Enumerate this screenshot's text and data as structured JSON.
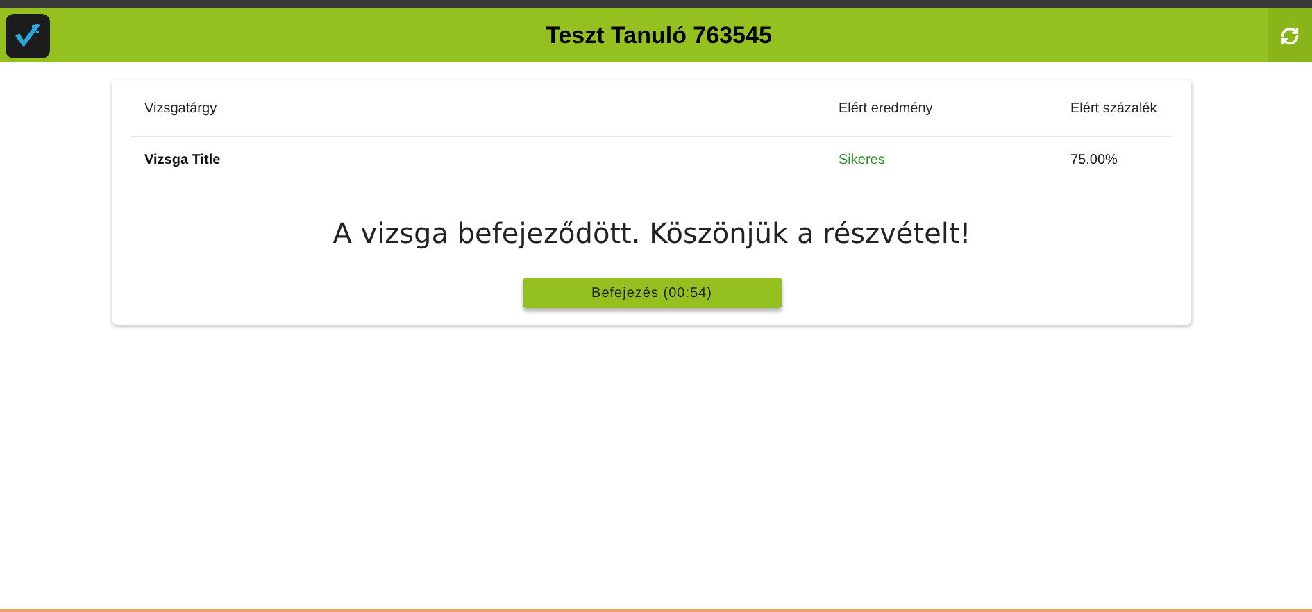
{
  "header": {
    "title": "Teszt Tanuló 763545"
  },
  "table": {
    "columns": [
      "Vizsgatárgy",
      "Elért eredmény",
      "Elért százalék"
    ],
    "rows": [
      {
        "subject": "Vizsga Title",
        "result": "Sikeres",
        "color": "#2e8b2e",
        "percent": "75.00%"
      }
    ]
  },
  "message": "A vizsga befejeződött. Köszönjük a részvételt!",
  "finish_button": {
    "label": "Befejezés (00:54)"
  }
}
